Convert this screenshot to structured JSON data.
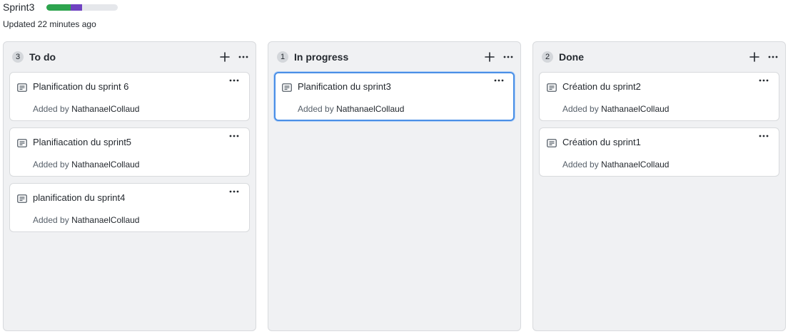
{
  "project": {
    "title": "Sprint3",
    "updated": "Updated 22 minutes ago",
    "progress": {
      "segments": [
        {
          "label": "done",
          "fraction": 0.34,
          "color": "#2da44e"
        },
        {
          "label": "in_progress",
          "fraction": 0.16,
          "color": "#6f42c1"
        }
      ]
    }
  },
  "columns": [
    {
      "title": "To do",
      "count": "3",
      "cards": [
        {
          "title": "Planification du sprint 6",
          "added_by": "Added by",
          "author": "NathanaelCollaud"
        },
        {
          "title": "Planifiacation du sprint5",
          "added_by": "Added by",
          "author": "NathanaelCollaud"
        },
        {
          "title": "planification du sprint4",
          "added_by": "Added by",
          "author": "NathanaelCollaud"
        }
      ]
    },
    {
      "title": "In progress",
      "count": "1",
      "cards": [
        {
          "title": "Planification du sprint3",
          "added_by": "Added by",
          "author": "NathanaelCollaud",
          "selected": true
        }
      ]
    },
    {
      "title": "Done",
      "count": "2",
      "cards": [
        {
          "title": "Création du sprint2",
          "added_by": "Added by",
          "author": "NathanaelCollaud"
        },
        {
          "title": "Création du sprint1",
          "added_by": "Added by",
          "author": "NathanaelCollaud"
        }
      ]
    }
  ],
  "icons": {
    "add": "plus-icon",
    "more": "kebab-horizontal-icon",
    "note": "note-icon"
  }
}
